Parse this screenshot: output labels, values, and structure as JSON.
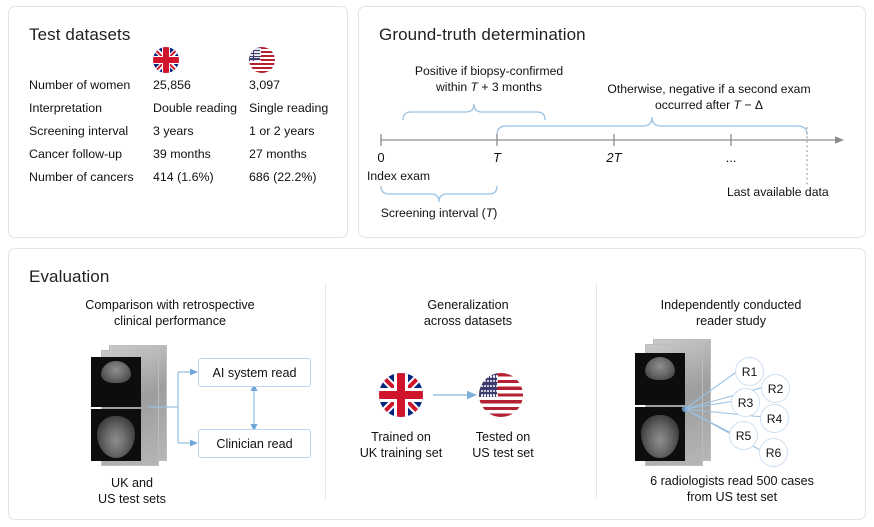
{
  "panels": {
    "test_datasets": {
      "title": "Test datasets",
      "columns": [
        "",
        "uk-flag",
        "us-flag"
      ],
      "rows": [
        {
          "label": "Number of women",
          "uk": "25,856",
          "us": "3,097"
        },
        {
          "label": "Interpretation",
          "uk": "Double reading",
          "us": "Single reading"
        },
        {
          "label": "Screening interval",
          "uk": "3 years",
          "us": "1 or 2 years"
        },
        {
          "label": "Cancer follow-up",
          "uk": "39 months",
          "us": "27 months"
        },
        {
          "label": "Number of cancers",
          "uk": "414 (1.6%)",
          "us": "686 (22.2%)"
        }
      ]
    },
    "ground_truth": {
      "title": "Ground-truth determination",
      "positive_label_line1": "Positive if biopsy-confirmed",
      "positive_label_line2_pre": "within ",
      "positive_label_line2_var": "T",
      "positive_label_line2_post": " + 3 months",
      "negative_label_line1": "Otherwise, negative if a second exam",
      "negative_label_line2_pre": "occurred after ",
      "negative_label_line2_var": "T",
      "negative_label_line2_post": " − Δ",
      "axis_ticks": [
        "0",
        "T",
        "2T",
        "..."
      ],
      "index_exam_label": "Index exam",
      "last_data_label": "Last available data",
      "screening_interval_pre": "Screening interval (",
      "screening_interval_var": "T",
      "screening_interval_post": ")"
    },
    "evaluation": {
      "title": "Evaluation",
      "columns": [
        {
          "title_line1": "Comparison with retrospective",
          "title_line2": "clinical performance",
          "box_top": "AI system read",
          "box_bottom": "Clinician read",
          "caption_line1": "UK and",
          "caption_line2": "US test sets"
        },
        {
          "title_line1": "Generalization",
          "title_line2": "across datasets",
          "left_caption_line1": "Trained on",
          "left_caption_line2": "UK training set",
          "right_caption_line1": "Tested on",
          "right_caption_line2": "US test set"
        },
        {
          "title_line1": "Independently conducted",
          "title_line2": "reader study",
          "readers": [
            "R1",
            "R2",
            "R3",
            "R4",
            "R5",
            "R6"
          ],
          "caption_line1": "6 radiologists read 500 cases",
          "caption_line2": "from US test set"
        }
      ]
    }
  },
  "colors": {
    "panel_border": "#e3e3e3",
    "accent_blue": "#9bc2e2",
    "box_border": "#bcd6ef",
    "axis_gray": "#8c8c8c",
    "uk_blue": "#00247d",
    "uk_red": "#cf142b",
    "us_red": "#b22234",
    "us_blue": "#3c3b6e"
  }
}
